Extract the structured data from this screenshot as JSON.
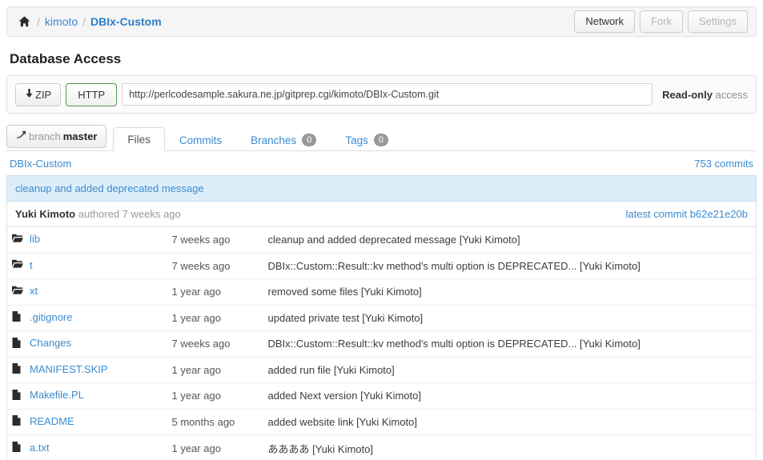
{
  "breadcrumb": {
    "home_icon": "home-icon",
    "separator": "/",
    "owner": "kimoto",
    "repo": "DBIx-Custom"
  },
  "header_actions": {
    "network": "Network",
    "fork": "Fork",
    "settings": "Settings"
  },
  "database_access": {
    "title": "Database Access",
    "zip_label": "ZIP",
    "zip_icon": "download-arrow-icon",
    "http_label": "HTTP",
    "url_value": "http://perlcodesample.sakura.ne.jp/gitprep.cgi/kimoto/DBIx-Custom.git",
    "access_bold": "Read-only",
    "access_rest": " access"
  },
  "branch": {
    "icon": "branch-arrow-icon",
    "prefix": "branch",
    "name": "master"
  },
  "tabs": [
    {
      "label": "Files",
      "badge": null,
      "active": true
    },
    {
      "label": "Commits",
      "badge": null,
      "active": false
    },
    {
      "label": "Branches",
      "badge": "0",
      "active": false
    },
    {
      "label": "Tags",
      "badge": "0",
      "active": false
    }
  ],
  "repo_header": {
    "name": "DBIx-Custom",
    "commits_count": "753 commits"
  },
  "latest_commit": {
    "message": "cleanup and added deprecated message",
    "author": "Yuki Kimoto",
    "meta": "authored 7 weeks ago",
    "link_label": "latest commit b62e21e20b"
  },
  "files": [
    {
      "icon": "folder-icon",
      "name": "lib",
      "age": "7 weeks ago",
      "message": "cleanup and added deprecated message [Yuki Kimoto]"
    },
    {
      "icon": "folder-icon",
      "name": "t",
      "age": "7 weeks ago",
      "message": "DBIx::Custom::Result::kv method's multi option is DEPRECATED... [Yuki Kimoto]"
    },
    {
      "icon": "folder-icon",
      "name": "xt",
      "age": "1 year ago",
      "message": "removed some files [Yuki Kimoto]"
    },
    {
      "icon": "file-icon",
      "name": ".gitignore",
      "age": "1 year ago",
      "message": "updated private test [Yuki Kimoto]"
    },
    {
      "icon": "file-icon",
      "name": "Changes",
      "age": "7 weeks ago",
      "message": "DBIx::Custom::Result::kv method's multi option is DEPRECATED... [Yuki Kimoto]"
    },
    {
      "icon": "file-icon",
      "name": "MANIFEST.SKIP",
      "age": "1 year ago",
      "message": "added run file [Yuki Kimoto]"
    },
    {
      "icon": "file-icon",
      "name": "Makefile.PL",
      "age": "1 year ago",
      "message": "added Next version [Yuki Kimoto]"
    },
    {
      "icon": "file-icon",
      "name": "README",
      "age": "5 months ago",
      "message": "added website link [Yuki Kimoto]"
    },
    {
      "icon": "file-icon",
      "name": "a.txt",
      "age": "1 year ago",
      "message": "ああああ [Yuki Kimoto]"
    }
  ],
  "colors": {
    "link": "#3b8bd0",
    "commit_bar_bg": "#ddeefb",
    "http_border": "#4f9c4f",
    "badge_bg": "#999999"
  }
}
